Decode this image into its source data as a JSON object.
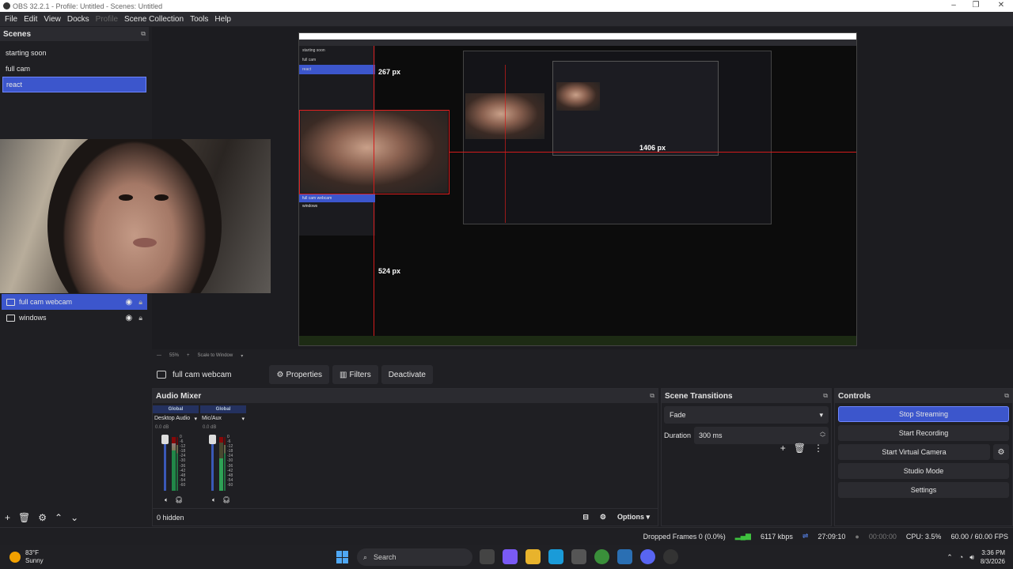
{
  "window": {
    "title": "OBS 32.2.1 - Profile: Untitled - Scenes: Untitled",
    "controls": [
      "–",
      "❐",
      "✕"
    ]
  },
  "menu": [
    "File",
    "Edit",
    "View",
    "Docks",
    "Profile",
    "Scene Collection",
    "Tools",
    "Help"
  ],
  "scenes": {
    "title": "Scenes",
    "items": [
      "starting soon",
      "full cam",
      "react"
    ],
    "selected": "react"
  },
  "sources": {
    "items": [
      "full cam webcam",
      "windows"
    ],
    "selected": "full cam webcam"
  },
  "preview": {
    "labels": {
      "width_px": "267 px",
      "height_px_a": "1406 px",
      "height_px_b": "1406 px",
      "mid_px": "524 px"
    },
    "inner": {
      "sources": [
        "full cam webcam",
        "windows"
      ],
      "scenes": [
        "starting soon",
        "full cam",
        "react"
      ]
    }
  },
  "zoom": {
    "level": "55%",
    "mode": "Scale to Window"
  },
  "source_toolbar": {
    "name": "full cam webcam",
    "properties": "Properties",
    "filters": "Filters",
    "deactivate": "Deactivate"
  },
  "audio_mixer": {
    "title": "Audio Mixer",
    "channels": [
      {
        "group": "Global",
        "name": "Desktop Audio",
        "db": "0.0 dB"
      },
      {
        "group": "Global",
        "name": "Mic/Aux",
        "db": "0.0 dB"
      }
    ],
    "scale": [
      "0",
      "-6",
      "-12",
      "-18",
      "-24",
      "-30",
      "-36",
      "-42",
      "-48",
      "-54",
      "-60"
    ],
    "hidden": "0 hidden",
    "options": "Options"
  },
  "transitions": {
    "title": "Scene Transitions",
    "selected": "Fade",
    "duration_label": "Duration",
    "duration": "300 ms"
  },
  "controls": {
    "title": "Controls",
    "stop_streaming": "Stop Streaming",
    "start_recording": "Start Recording",
    "start_virtual_camera": "Start Virtual Camera",
    "studio_mode": "Studio Mode",
    "settings": "Settings"
  },
  "status": {
    "dropped_frames": "Dropped Frames 0 (0.0%)",
    "bitrate": "6117 kbps",
    "stream_time": "27:09:10",
    "record_time": "00:00:00",
    "cpu": "CPU: 3.5%",
    "fps": "60.00 / 60.00 FPS"
  },
  "taskbar": {
    "temp": "83°F",
    "weather": "Sunny",
    "search_placeholder": "Search",
    "time": "3:36 PM",
    "date": "8/3/2026"
  },
  "colors": {
    "accent": "#3c56cc",
    "selection_red": "#e02020",
    "meter_green": "#22aa55"
  }
}
